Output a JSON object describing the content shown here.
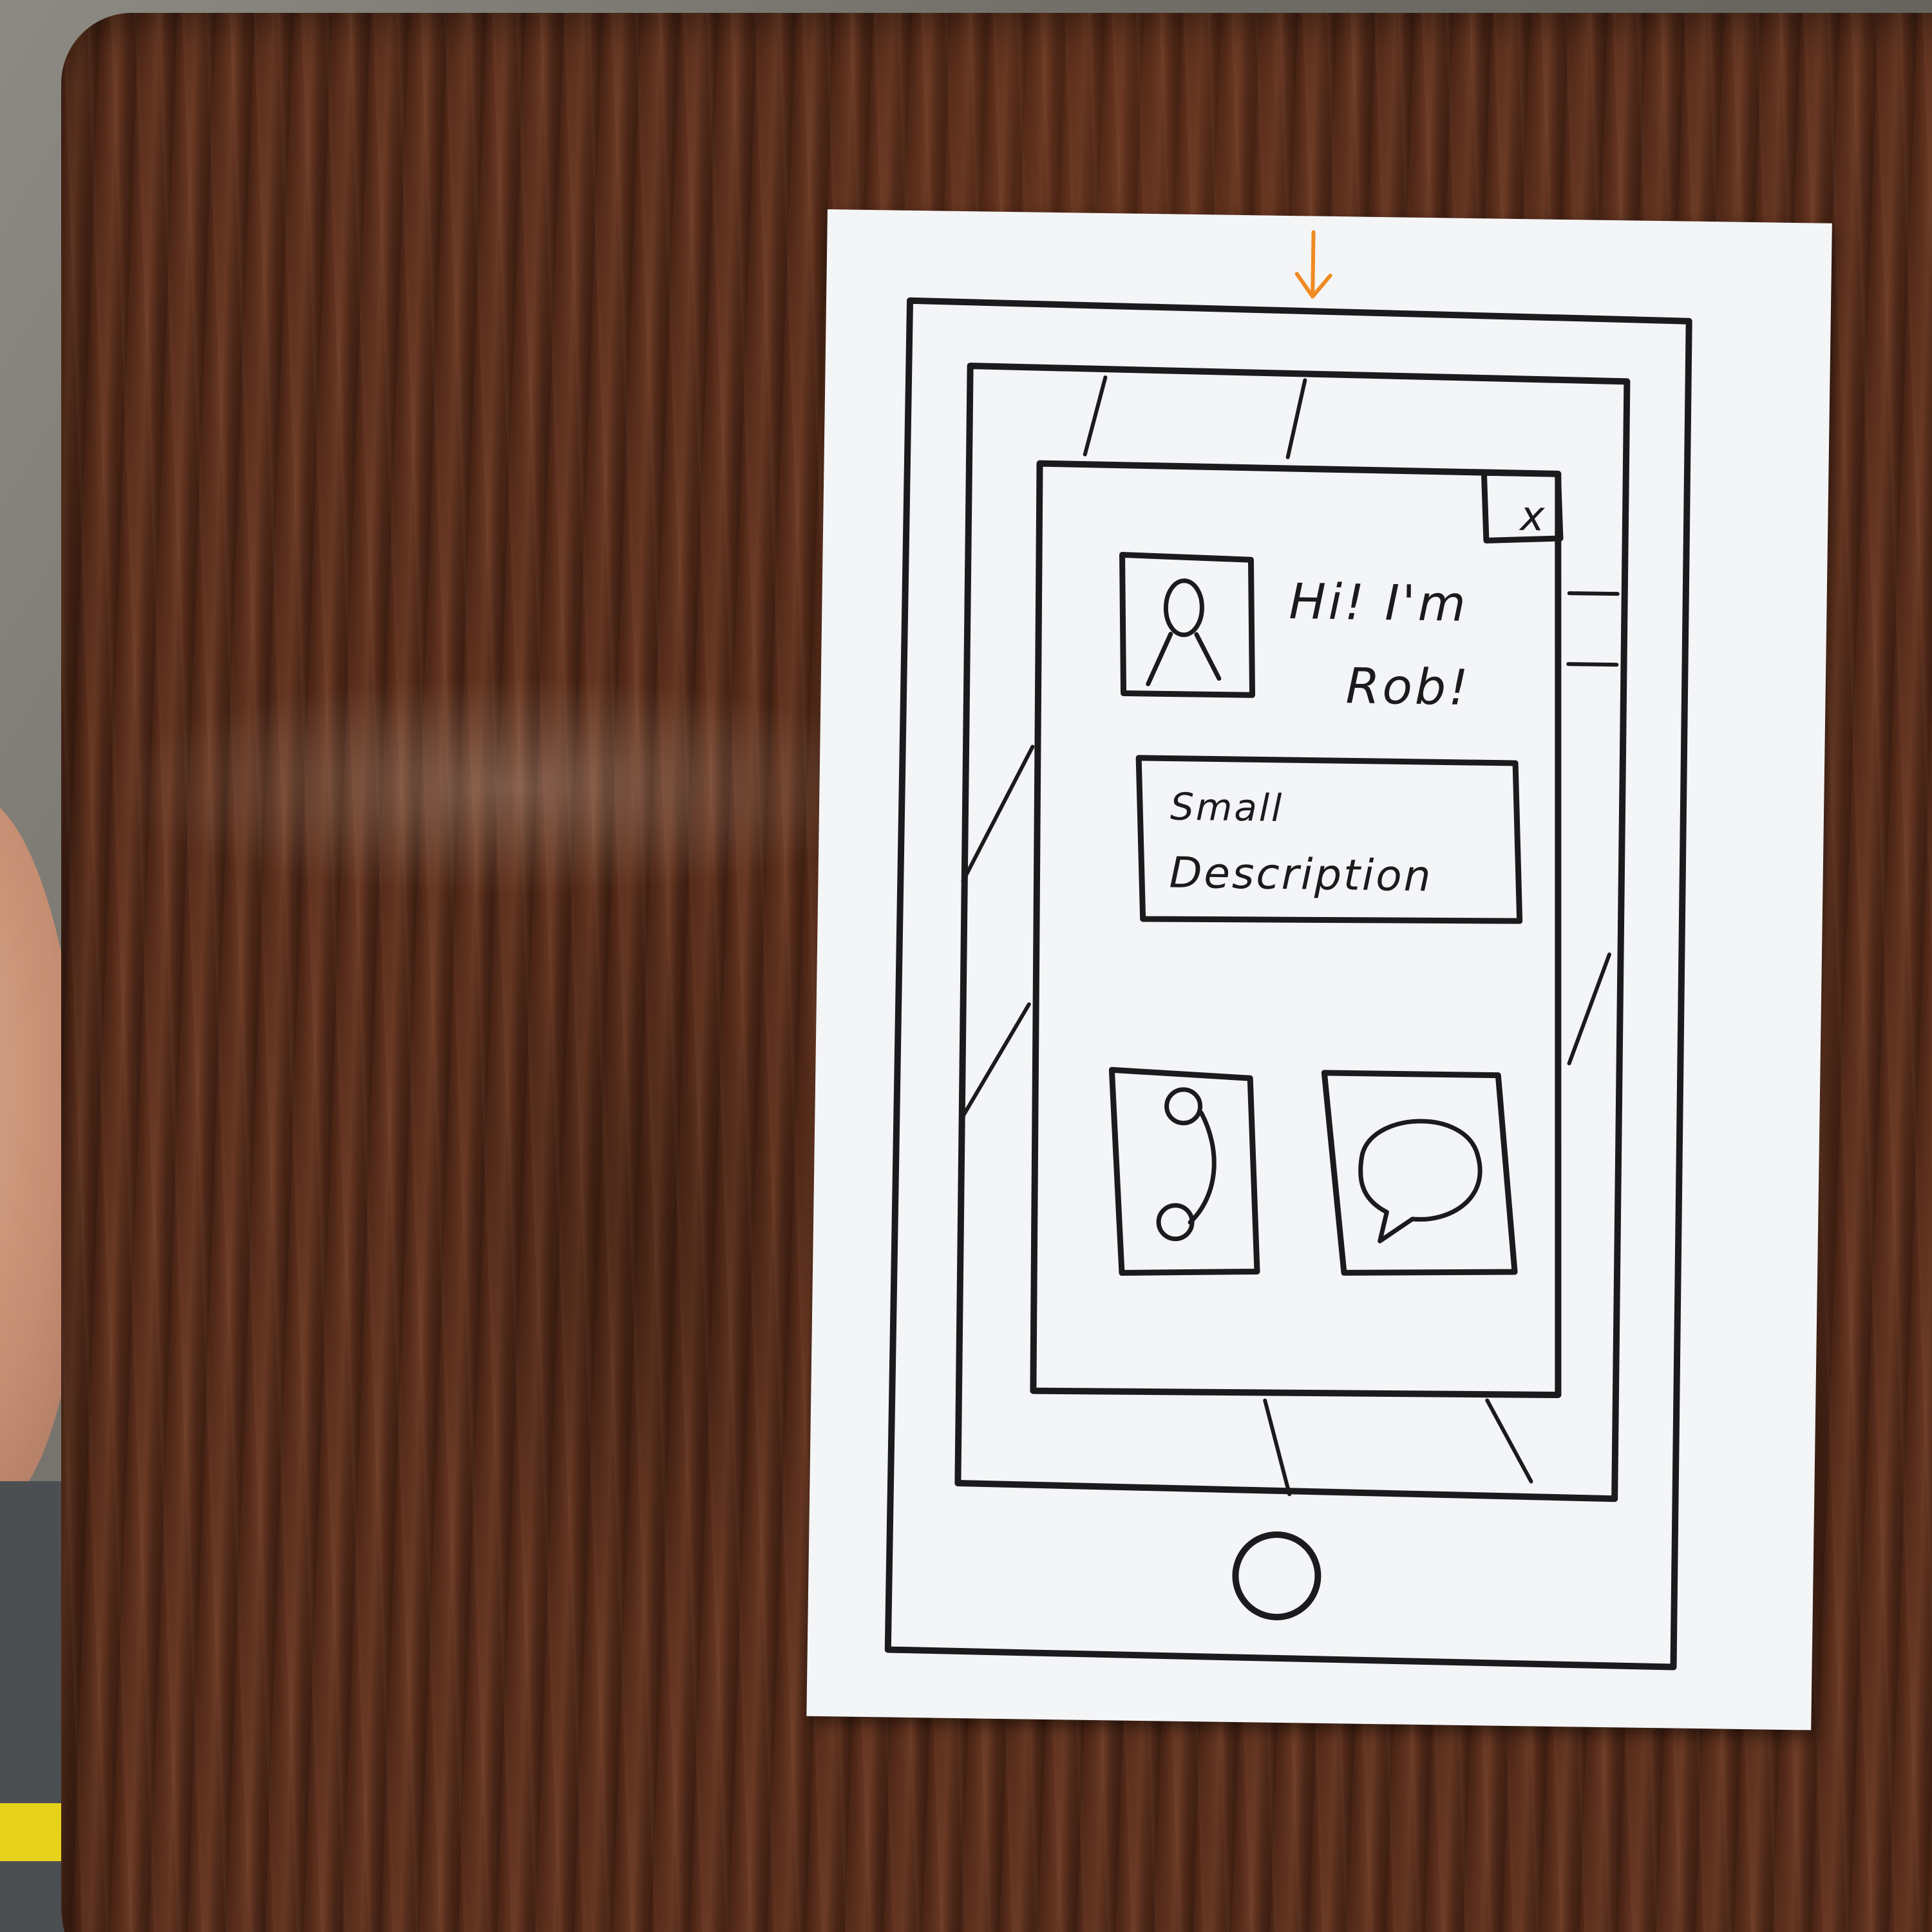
{
  "sketch": {
    "greeting_line1": "Hi! I'm",
    "greeting_line2": "Rob!",
    "description_line1": "Small",
    "description_line2": "Description",
    "close_glyph": "x",
    "arrow_color": "#f08a22",
    "ink_color": "#1b1b1d",
    "icons": [
      "down-arrow-icon",
      "close-icon",
      "profile-avatar-icon",
      "phone-icon",
      "chat-bubble-icon",
      "home-button-icon"
    ]
  }
}
